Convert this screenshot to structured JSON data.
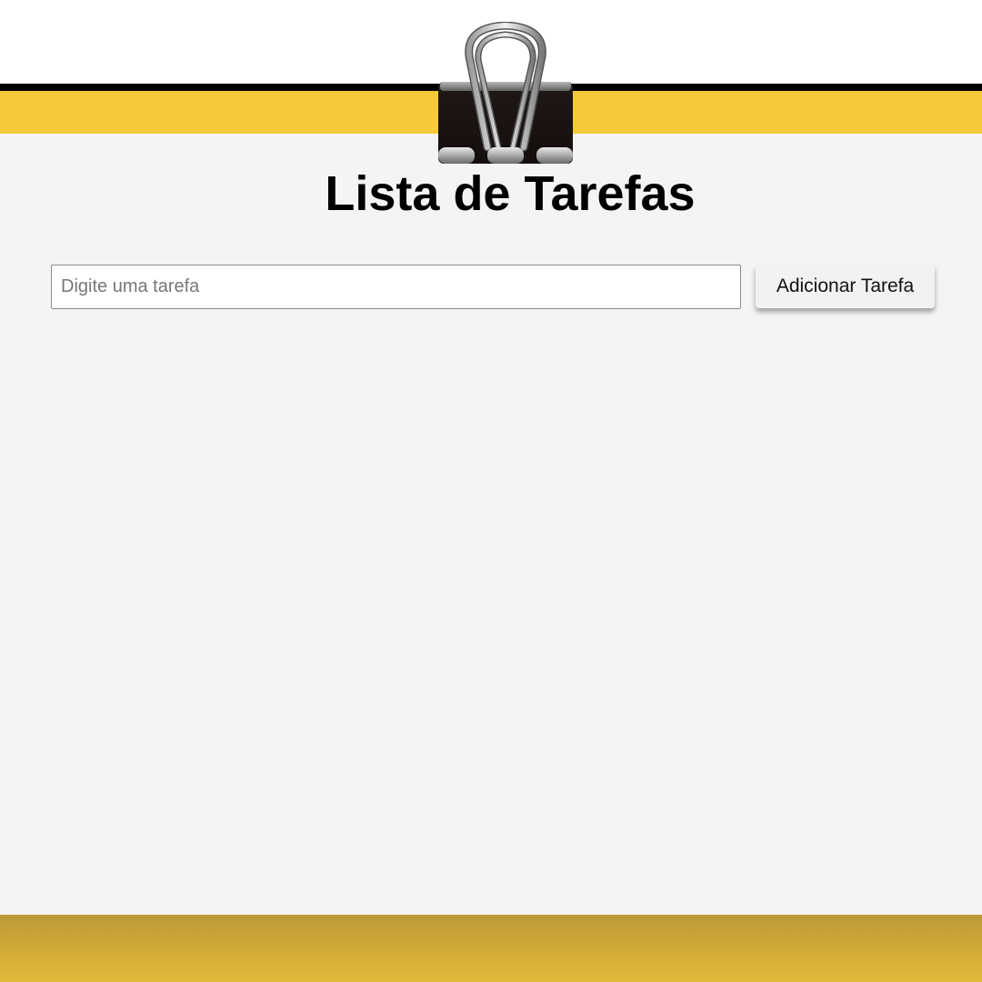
{
  "header": {
    "title": "Lista de Tarefas"
  },
  "form": {
    "input_value": "",
    "input_placeholder": "Digite uma tarefa",
    "add_button_label": "Adicionar Tarefa"
  },
  "tasks": [],
  "icons": {
    "clip": "binder-clip-icon"
  },
  "colors": {
    "background": "#f4f4f4",
    "accent_yellow": "#f5c93a",
    "stripe_black": "#000000",
    "footer_gold": "#cfa937"
  }
}
